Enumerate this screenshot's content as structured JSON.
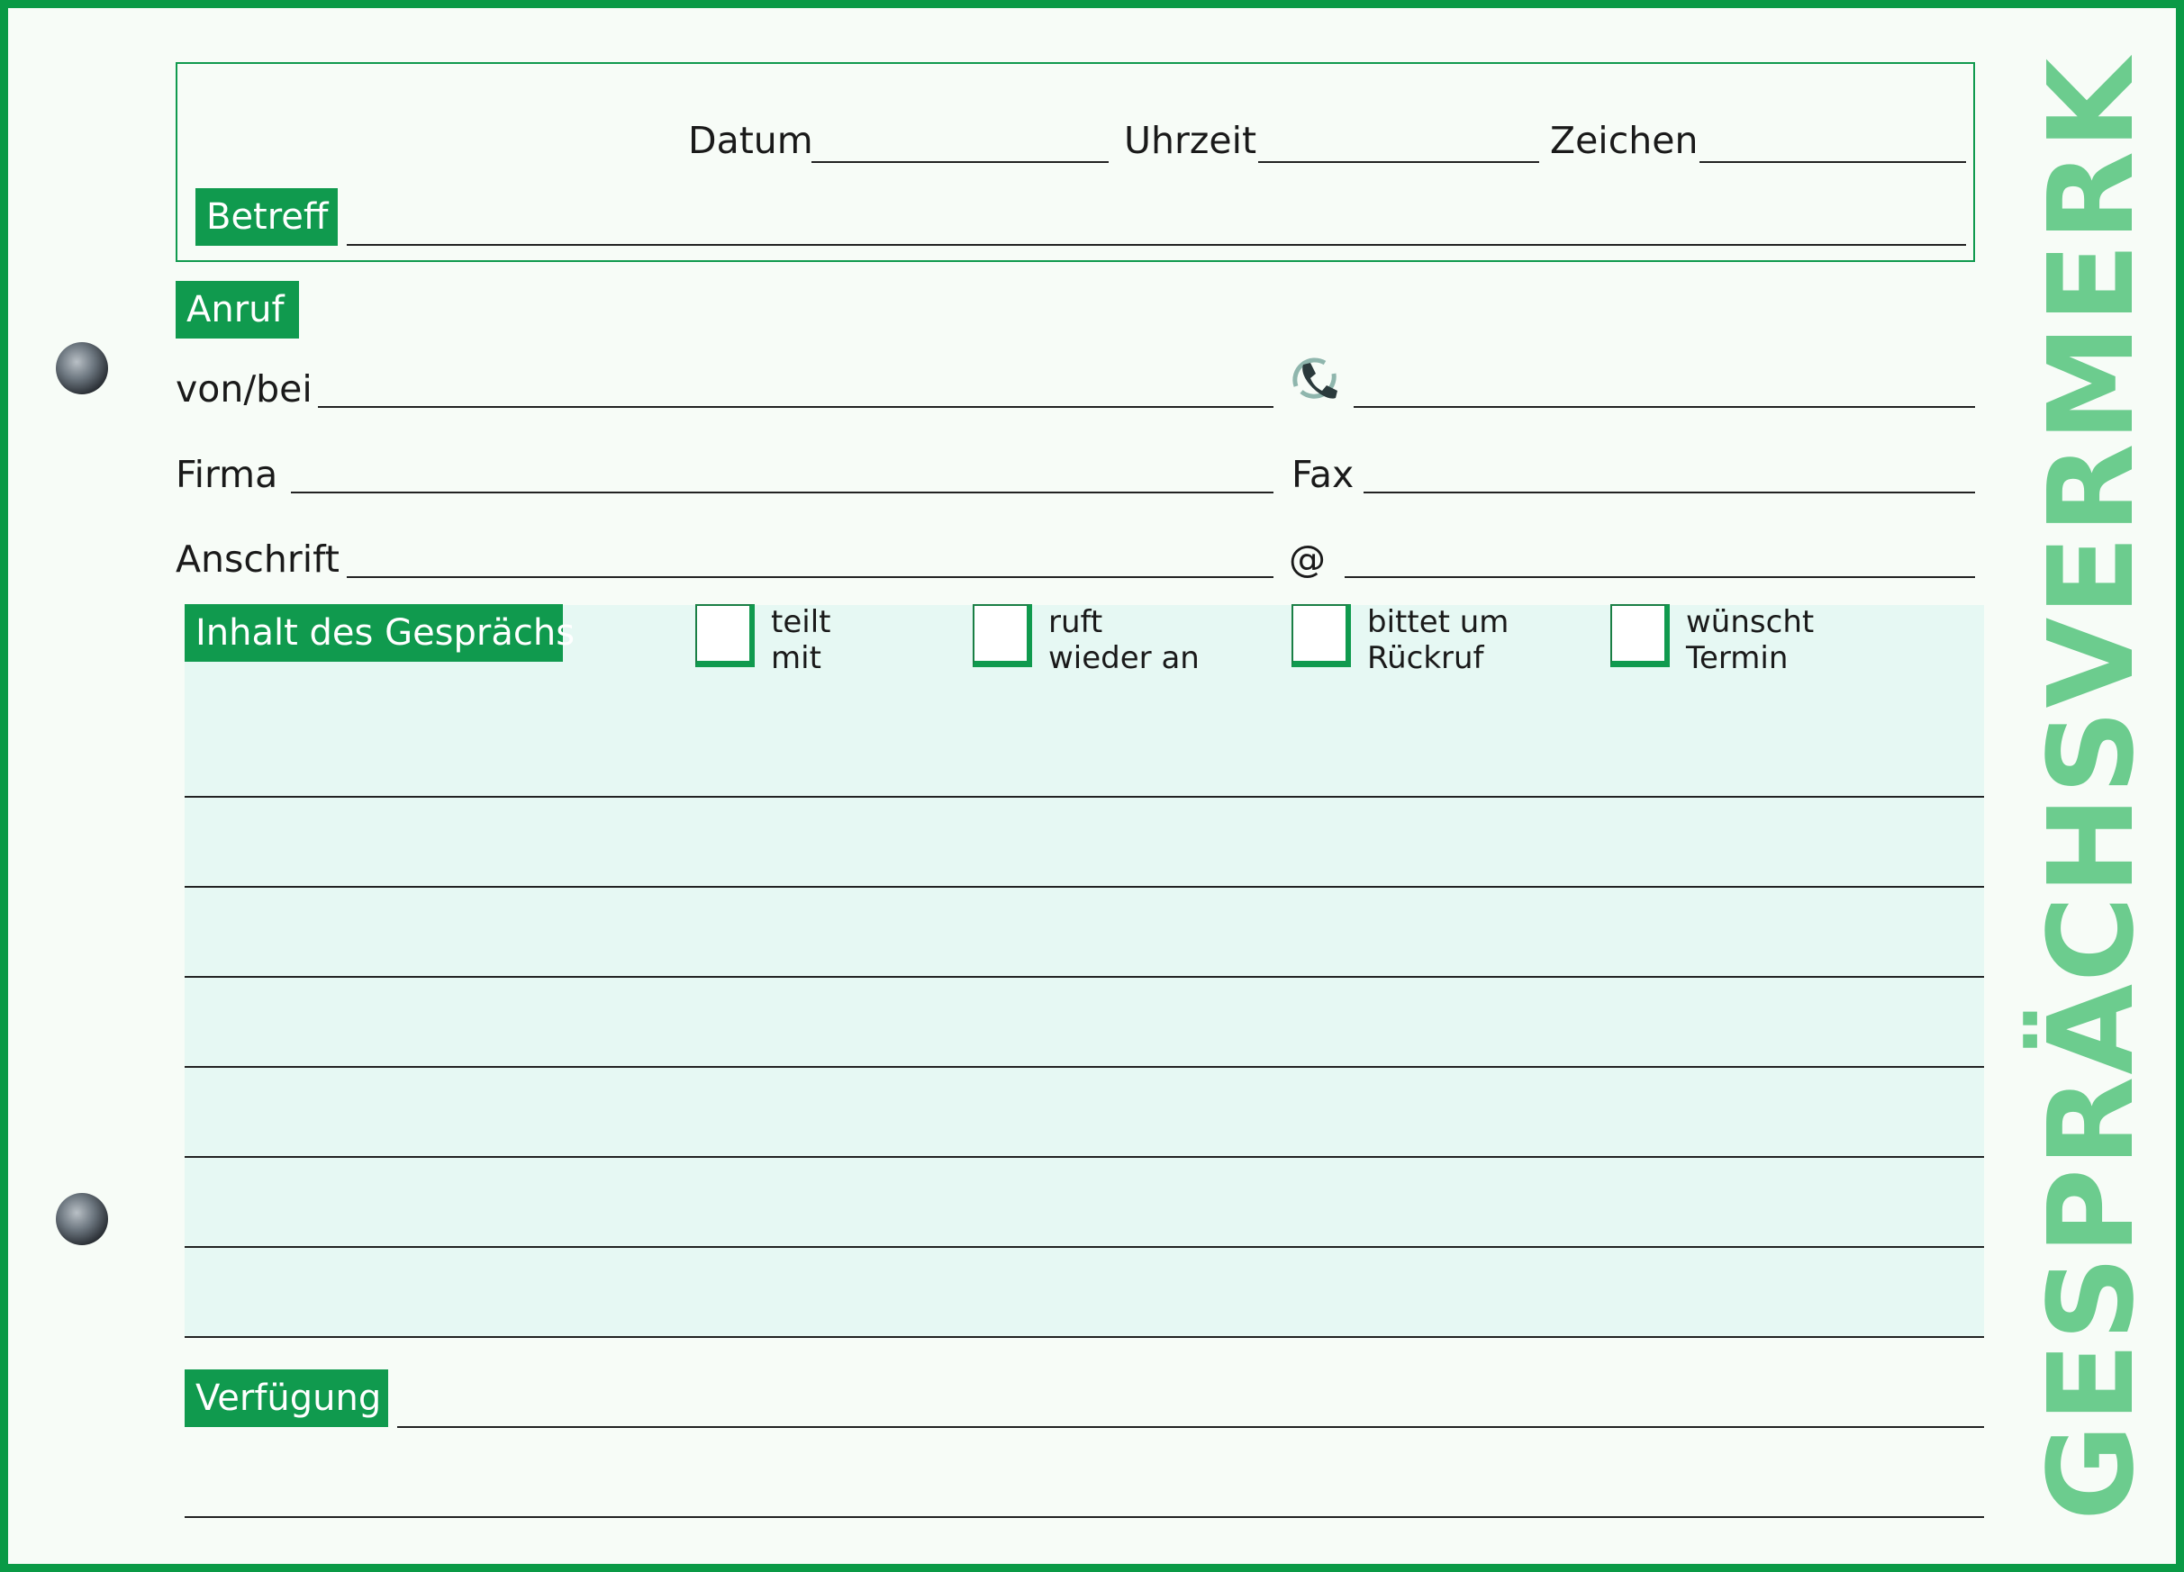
{
  "header": {
    "datum_label": "Datum",
    "uhrzeit_label": "Uhrzeit",
    "zeichen_label": "Zeichen",
    "betreff_label": "Betreff"
  },
  "anruf": {
    "section_label": "Anruf",
    "von_bei_label": "von/bei",
    "phone_icon": "phone-icon",
    "firma_label": "Firma",
    "fax_label": "Fax",
    "anschrift_label": "Anschrift",
    "email_label": "@"
  },
  "inhalt": {
    "section_label": "Inhalt des Gesprächs",
    "checkboxes": [
      {
        "line1": "teilt",
        "line2": "mit"
      },
      {
        "line1": "ruft",
        "line2": "wieder an"
      },
      {
        "line1": "bittet um",
        "line2": "Rückruf"
      },
      {
        "line1": "wünscht",
        "line2": "Termin"
      }
    ]
  },
  "verfuegung": {
    "section_label": "Verfügung"
  },
  "vertical_title": "GESPRÄCHSVERMERK",
  "colors": {
    "border_green": "#0a9a46",
    "label_green": "#109a4e",
    "title_green": "#6ccc8e",
    "content_bg": "#e6f8f3"
  }
}
